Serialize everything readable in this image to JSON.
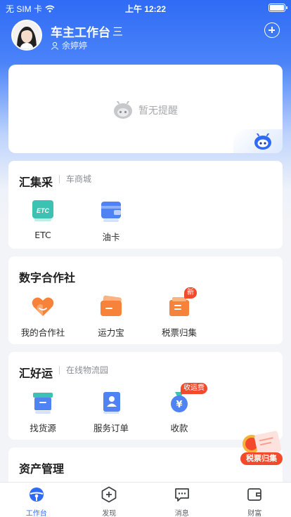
{
  "status_bar": {
    "carrier": "无 SIM 卡",
    "time": "上午 12:22"
  },
  "header": {
    "title": "车主工作台",
    "switch_icon": "三",
    "user_name": "余婷婷"
  },
  "notice": {
    "empty_text": "暂无提醒"
  },
  "sections": [
    {
      "title": "汇集采",
      "subtitle": "车商城",
      "items": [
        {
          "label": "ETC",
          "icon": "etc-card-icon",
          "badge": ""
        },
        {
          "label": "油卡",
          "icon": "fuel-card-icon",
          "badge": ""
        }
      ]
    },
    {
      "title": "数字合作社",
      "subtitle": "",
      "items": [
        {
          "label": "我的合作社",
          "icon": "heart-cooperative-icon",
          "badge": ""
        },
        {
          "label": "运力宝",
          "icon": "wallet-icon",
          "badge": ""
        },
        {
          "label": "税票归集",
          "icon": "tax-ticket-icon",
          "badge": "新"
        }
      ]
    },
    {
      "title": "汇好运",
      "subtitle": "在线物流园",
      "items": [
        {
          "label": "找货源",
          "icon": "cargo-box-icon",
          "badge": ""
        },
        {
          "label": "服务订单",
          "icon": "order-person-icon",
          "badge": ""
        },
        {
          "label": "收款",
          "icon": "yuan-bag-icon",
          "badge": "收运费"
        }
      ]
    },
    {
      "title": "资产管理",
      "subtitle": "",
      "items": []
    }
  ],
  "floating_promo": {
    "text": "税票归集"
  },
  "tabs": [
    {
      "label": "工作台",
      "icon": "steering-wheel-icon",
      "active": true
    },
    {
      "label": "发现",
      "icon": "discover-plus-icon",
      "active": false
    },
    {
      "label": "消息",
      "icon": "message-icon",
      "active": false
    },
    {
      "label": "财富",
      "icon": "wallet-outline-icon",
      "active": false
    }
  ],
  "colors": {
    "primary": "#2f6bf6",
    "badge": "#f44a2c",
    "orange": "#f7833a",
    "teal": "#3cc2b3",
    "blue_icon": "#4f82f4"
  }
}
